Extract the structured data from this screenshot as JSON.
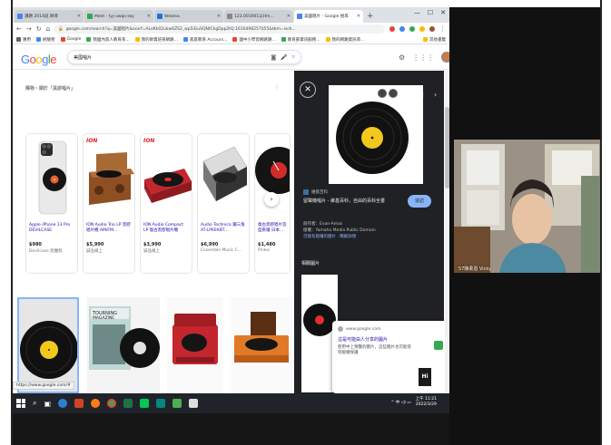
{
  "browser": {
    "tabs": [
      {
        "title": "課題 2014班 師導",
        "color": "#4285f4",
        "active": false
      },
      {
        "title": "Meet - tyj-uwqs-sky",
        "color": "#34a853",
        "active": false
      },
      {
        "title": "WebISS",
        "color": "#1a73e8",
        "active": false
      },
      {
        "title": "123.001001以Hm...",
        "color": "#888888",
        "active": false
      },
      {
        "title": "美國唱片 - Google 搜尋",
        "color": "#4285f4",
        "active": true
      }
    ],
    "new_tab": "+",
    "window_controls": [
      "—",
      "☐",
      "✕"
    ],
    "url": "google.com/search?q=美國唱片&sxsrf=ALeKk02ukw6ZS2_wp5iGuSQNtCkgDpp2tQ:1616498257055&tbm=isch...",
    "bookmarks": [
      {
        "label": "應用",
        "color": "#5f6368"
      },
      {
        "label": "經驗營",
        "color": "#4285f4"
      },
      {
        "label": "Google",
        "color": "#ea4335"
      },
      {
        "label": "我國內容人教育系...",
        "color": "#34a853"
      },
      {
        "label": "我的師資培育網路...",
        "color": "#fbbc05"
      },
      {
        "label": "家庭教育 Accours...",
        "color": "#4285f4"
      },
      {
        "label": "國中小學習網路題...",
        "color": "#ea4335"
      },
      {
        "label": "教育部資訊服務...",
        "color": "#34a853"
      },
      {
        "label": "我的網路資訊導...",
        "color": "#fbbc05"
      },
      {
        "label": "其他書籤",
        "color": "#fbbc05"
      }
    ]
  },
  "google": {
    "logo_letters": [
      {
        "ch": "G",
        "color": "#4285f4"
      },
      {
        "ch": "o",
        "color": "#ea4335"
      },
      {
        "ch": "o",
        "color": "#fbbc05"
      },
      {
        "ch": "g",
        "color": "#4285f4"
      },
      {
        "ch": "l",
        "color": "#34a853"
      },
      {
        "ch": "e",
        "color": "#ea4335"
      }
    ],
    "query": "美國唱片",
    "section_title": "購物・關於「黑膠唱片」",
    "more": "⋮",
    "products": [
      {
        "brand": "",
        "name": "Apple iPhone 13 Pro DEVILCASE",
        "price": "$980",
        "store": "Devilcase 惡魔殼",
        "kind": "phone"
      },
      {
        "brand": "ION",
        "name": "ION Audio Trio LP 黑膠唱片機 AM/FM...",
        "price": "$5,990",
        "store": "誠品線上",
        "kind": "player-wood"
      },
      {
        "brand": "ION",
        "name": "ION Audio Compact LP 復古黑膠唱片機",
        "price": "$3,990",
        "store": "誠品線上",
        "kind": "player-red"
      },
      {
        "brand": "",
        "name": "Audio Technica 鐵三角 AT-LP60XBT...",
        "price": "$6,990",
        "store": "Ensemble Music C...",
        "kind": "player-white"
      },
      {
        "brand": "",
        "name": "復古黑膠唱片造型掛鐘 日本...",
        "price": "$1,480",
        "store": "Pinkoi",
        "kind": "clock"
      }
    ],
    "status_url": "https://www.google.com/#"
  },
  "panel": {
    "source": "維基百科",
    "title": "留聲機唱片 - 維基百科，自由的百科全書",
    "visit": "造訪",
    "meta_lines": [
      "創作者：Evan-Amos",
      "版權：Yamaha Media Public Domain",
      "可能有版權的圖片 · 瞭解詳情"
    ],
    "related": "相關圖片",
    "close": "✕",
    "prev": "‹",
    "next": "›"
  },
  "popup": {
    "source": "www.google.com",
    "title": "這是可能由人分享的圖片",
    "text": "使用中上預覽的圖片，這些圖片也可能受到版權保護",
    "hi": "Hi"
  },
  "taskbar": {
    "time": "上午 11:21",
    "date": "2022/3/29",
    "tray": "^ 中 ◁) ▭"
  },
  "webcam": {
    "name": "57陳柔恩 Vicky"
  },
  "colors": {
    "vinyl": "#111111",
    "label": "#f2c81d",
    "panel_bg": "#202124",
    "taskbar": "#20242a"
  }
}
